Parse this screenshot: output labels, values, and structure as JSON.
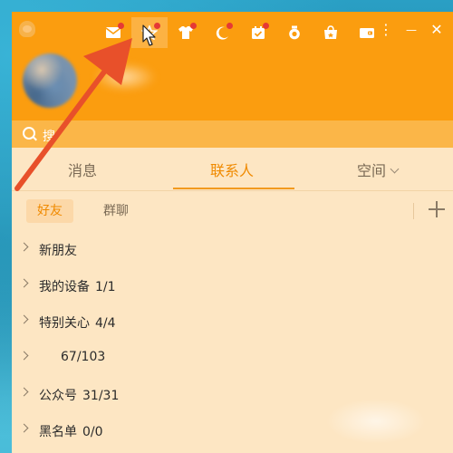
{
  "toolbar": {
    "buttons": [
      {
        "name": "mail-icon",
        "badge": true
      },
      {
        "name": "star-icon",
        "badge": true,
        "active": true
      },
      {
        "name": "shirt-icon",
        "badge": true
      },
      {
        "name": "moon-icon",
        "badge": true
      },
      {
        "name": "calendar-check-icon",
        "badge": true
      },
      {
        "name": "medal-icon",
        "badge": false
      },
      {
        "name": "gift-bag-icon",
        "badge": false
      },
      {
        "name": "wallet-icon",
        "badge": false
      }
    ],
    "more_glyph": "⋮",
    "minimize_glyph": "—",
    "close_glyph": "✕"
  },
  "search": {
    "placeholder": "搜"
  },
  "tabs": {
    "messages": "消息",
    "contacts": "联系人",
    "space": "空间"
  },
  "subtabs": {
    "friends": "好友",
    "groups": "群聊"
  },
  "friend_groups": [
    {
      "name": "新朋友",
      "count": ""
    },
    {
      "name": "我的设备",
      "count": "1/1"
    },
    {
      "name": "特别关心",
      "count": "4/4"
    },
    {
      "name": "",
      "count": "67/103"
    },
    {
      "name": "公众号",
      "count": "31/31"
    },
    {
      "name": "黑名单",
      "count": "0/0"
    }
  ],
  "colors": {
    "header": "#fb9d0f",
    "accent": "#f08a00",
    "panel": "#fde6c3",
    "badge": "#e53935",
    "annotation_arrow": "#e8502a"
  }
}
